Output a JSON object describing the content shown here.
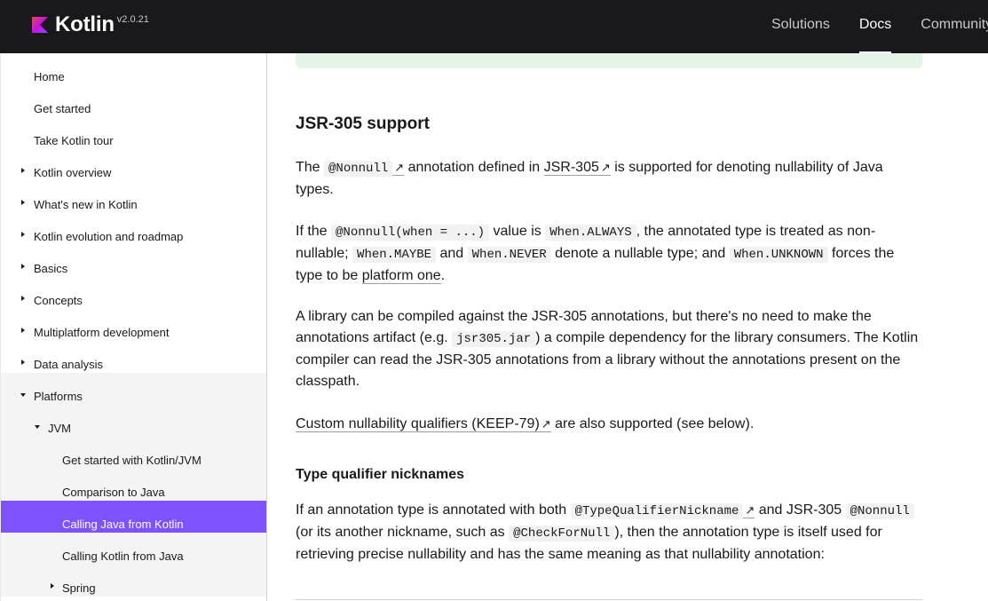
{
  "header": {
    "logo_text": "Kotlin",
    "version": "v2.0.21",
    "nav": [
      "Solutions",
      "Docs",
      "Community"
    ],
    "active_nav": "Docs"
  },
  "sidebar": {
    "items": [
      {
        "label": "Home"
      },
      {
        "label": "Get started"
      },
      {
        "label": "Take Kotlin tour"
      },
      {
        "label": "Kotlin overview"
      },
      {
        "label": "What's new in Kotlin"
      },
      {
        "label": "Kotlin evolution and roadmap"
      },
      {
        "label": "Basics"
      },
      {
        "label": "Concepts"
      },
      {
        "label": "Multiplatform development"
      },
      {
        "label": "Data analysis"
      },
      {
        "label": "Platforms"
      },
      {
        "label": "JVM"
      },
      {
        "label": "Get started with Kotlin/JVM"
      },
      {
        "label": "Comparison to Java"
      },
      {
        "label": "Calling Java from Kotlin"
      },
      {
        "label": "Calling Kotlin from Java"
      },
      {
        "label": "Spring"
      }
    ]
  },
  "article": {
    "heading": "JSR-305 support",
    "p1": {
      "t1": "The ",
      "code1": "@Nonnull",
      "t2": " annotation defined in ",
      "link1": "JSR-305",
      "t3": " is supported for denoting nullability of Java types."
    },
    "p2": {
      "t1": "If the ",
      "code1": "@Nonnull(when = ...)",
      "t2": " value is ",
      "code2": "When.ALWAYS",
      "t3": ", the annotated type is treated as non-nullable; ",
      "code3": "When.MAYBE",
      "t4": " and ",
      "code4": "When.NEVER",
      "t5": " denote a nullable type; and ",
      "code5": "When.UNKNOWN",
      "t6": " forces the type to be ",
      "link1": "platform one",
      "t7": "."
    },
    "p3": {
      "t1": "A library can be compiled against the JSR-305 annotations, but there's no need to make the annotations artifact (e.g. ",
      "code1": "jsr305.jar",
      "t2": ") a compile dependency for the library consumers. The Kotlin compiler can read the JSR-305 annotations from a library without the annotations present on the classpath."
    },
    "p4": {
      "link1": "Custom nullability qualifiers (KEEP-79)",
      "t1": " are also supported (see below)."
    },
    "subheading": "Type qualifier nicknames",
    "p5": {
      "t1": "If an annotation type is annotated with both ",
      "code1": "@TypeQualifierNickname",
      "t2": " and JSR-305 ",
      "code2": "@Nonnull",
      "t3": " (or its another nickname, such as ",
      "code3": "@CheckForNull",
      "t4": "), then the annotation type is itself used for retrieving precise nullability and has the same meaning as that nullability annotation:"
    }
  },
  "icons": {
    "external_link": "↗"
  },
  "colors": {
    "header_bg": "#19191c",
    "accent": "#7f52ff",
    "notice_bg": "#e4f4e6",
    "code_bg": "#f2f2f3"
  }
}
